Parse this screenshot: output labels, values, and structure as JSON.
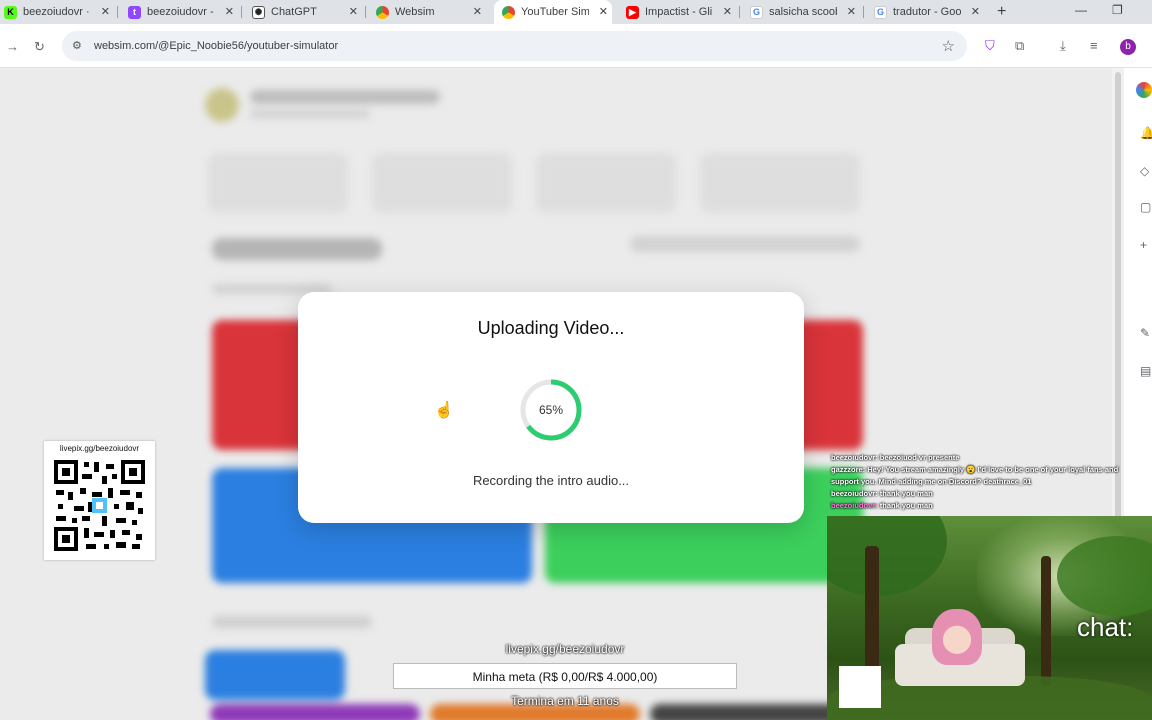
{
  "browser": {
    "tabs": [
      {
        "label": "beezoiudovr · S",
        "favicon": "kick-icon",
        "color": "#53fc18"
      },
      {
        "label": "beezoiudovr -",
        "favicon": "twitch-icon",
        "color": "#9146ff"
      },
      {
        "label": "ChatGPT",
        "favicon": "chatgpt-icon",
        "color": "#202123"
      },
      {
        "label": "Websim",
        "favicon": "chrome-icon",
        "color": "#4285f4"
      },
      {
        "label": "YouTuber Sim",
        "favicon": "chrome-icon",
        "color": "#4285f4",
        "active": true
      },
      {
        "label": "Impactist - Gli",
        "favicon": "youtube-icon",
        "color": "#ff0000"
      },
      {
        "label": "salsicha scoob",
        "favicon": "google-icon",
        "color": "#4285f4"
      },
      {
        "label": "tradutor - Goo",
        "favicon": "google-icon",
        "color": "#4285f4"
      }
    ],
    "url": "websim.com/@Epic_Noobie56/youtuber-simulator",
    "profile_initial": "b"
  },
  "modal": {
    "title": "Uploading Video...",
    "progress_percent": 65,
    "progress_label": "65%",
    "status": "Recording the intro audio...",
    "progress_color": "#2ecc71"
  },
  "overlay": {
    "qr_label": "livepix.gg/beezoiudovr",
    "chat_messages": [
      {
        "user": "beezoiudovr:",
        "text": "beezoiuod vr presente"
      },
      {
        "user": "gazzzore:",
        "text": "Hey! You stream amazingly 😮 I'd love to be one of your loyal fans and support you. Mind adding me on Discord? deathrace_01"
      },
      {
        "user": "beezoiudovr:",
        "text": "thank you man"
      },
      {
        "user": "beezoiudovr:",
        "text": "thank you man"
      }
    ],
    "camera_chat_label": "chat:",
    "donation_url": "livepix.gg/beezoiudovr",
    "goal_text": "Minha meta (R$ 0,00/R$ 4.000,00)",
    "goal_progress": 0,
    "goal_ends": "Termina em 11 anos"
  }
}
